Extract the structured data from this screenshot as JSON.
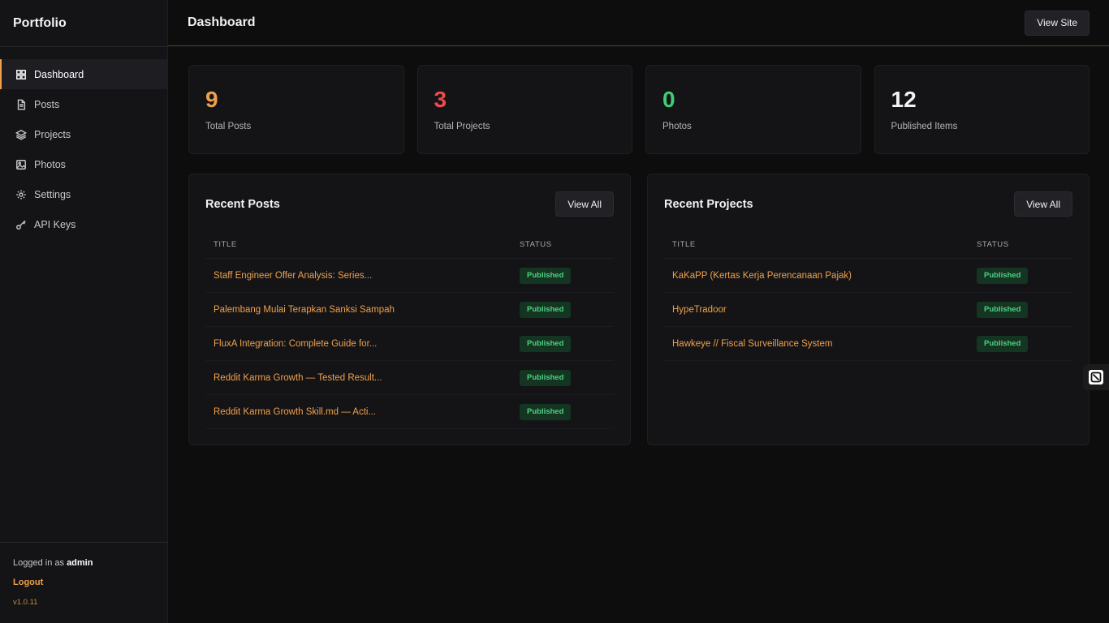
{
  "sidebar": {
    "brand": "Portfolio",
    "items": [
      {
        "label": "Dashboard",
        "icon": "grid-icon",
        "active": true
      },
      {
        "label": "Posts",
        "icon": "document-icon",
        "active": false
      },
      {
        "label": "Projects",
        "icon": "layers-icon",
        "active": false
      },
      {
        "label": "Photos",
        "icon": "image-icon",
        "active": false
      },
      {
        "label": "Settings",
        "icon": "gear-icon",
        "active": false
      },
      {
        "label": "API Keys",
        "icon": "key-icon",
        "active": false
      }
    ],
    "footer": {
      "logged_prefix": "Logged in as",
      "username": "admin",
      "logout": "Logout",
      "version": "v1.0.11"
    }
  },
  "header": {
    "title": "Dashboard",
    "view_site": "View Site"
  },
  "stats": [
    {
      "value": "9",
      "label": "Total Posts",
      "color": "#f0a04a"
    },
    {
      "value": "3",
      "label": "Total Projects",
      "color": "#ef4a4a"
    },
    {
      "value": "0",
      "label": "Photos",
      "color": "#3ecf74"
    },
    {
      "value": "12",
      "label": "Published Items",
      "color": "#f2f2f2"
    }
  ],
  "recent_posts": {
    "title": "Recent Posts",
    "view_all": "View All",
    "columns": [
      "TITLE",
      "STATUS"
    ],
    "rows": [
      {
        "title": "Staff Engineer Offer Analysis: Series...",
        "status": "Published"
      },
      {
        "title": "Palembang Mulai Terapkan Sanksi Sampah",
        "status": "Published"
      },
      {
        "title": "FluxA Integration: Complete Guide for...",
        "status": "Published"
      },
      {
        "title": "Reddit Karma Growth — Tested Result...",
        "status": "Published"
      },
      {
        "title": "Reddit Karma Growth Skill.md — Acti...",
        "status": "Published"
      }
    ]
  },
  "recent_projects": {
    "title": "Recent Projects",
    "view_all": "View All",
    "columns": [
      "TITLE",
      "STATUS"
    ],
    "rows": [
      {
        "title": "KaKaPP (Kertas Kerja Perencanaan Pajak)",
        "status": "Published"
      },
      {
        "title": "HypeTradoor",
        "status": "Published"
      },
      {
        "title": "Hawkeye // Fiscal Surveillance System",
        "status": "Published"
      }
    ]
  },
  "colors": {
    "accent": "#f0a04a",
    "background": "#0d0d0e",
    "panel": "#141417",
    "badge_bg": "#133522",
    "badge_text": "#4fd180"
  }
}
